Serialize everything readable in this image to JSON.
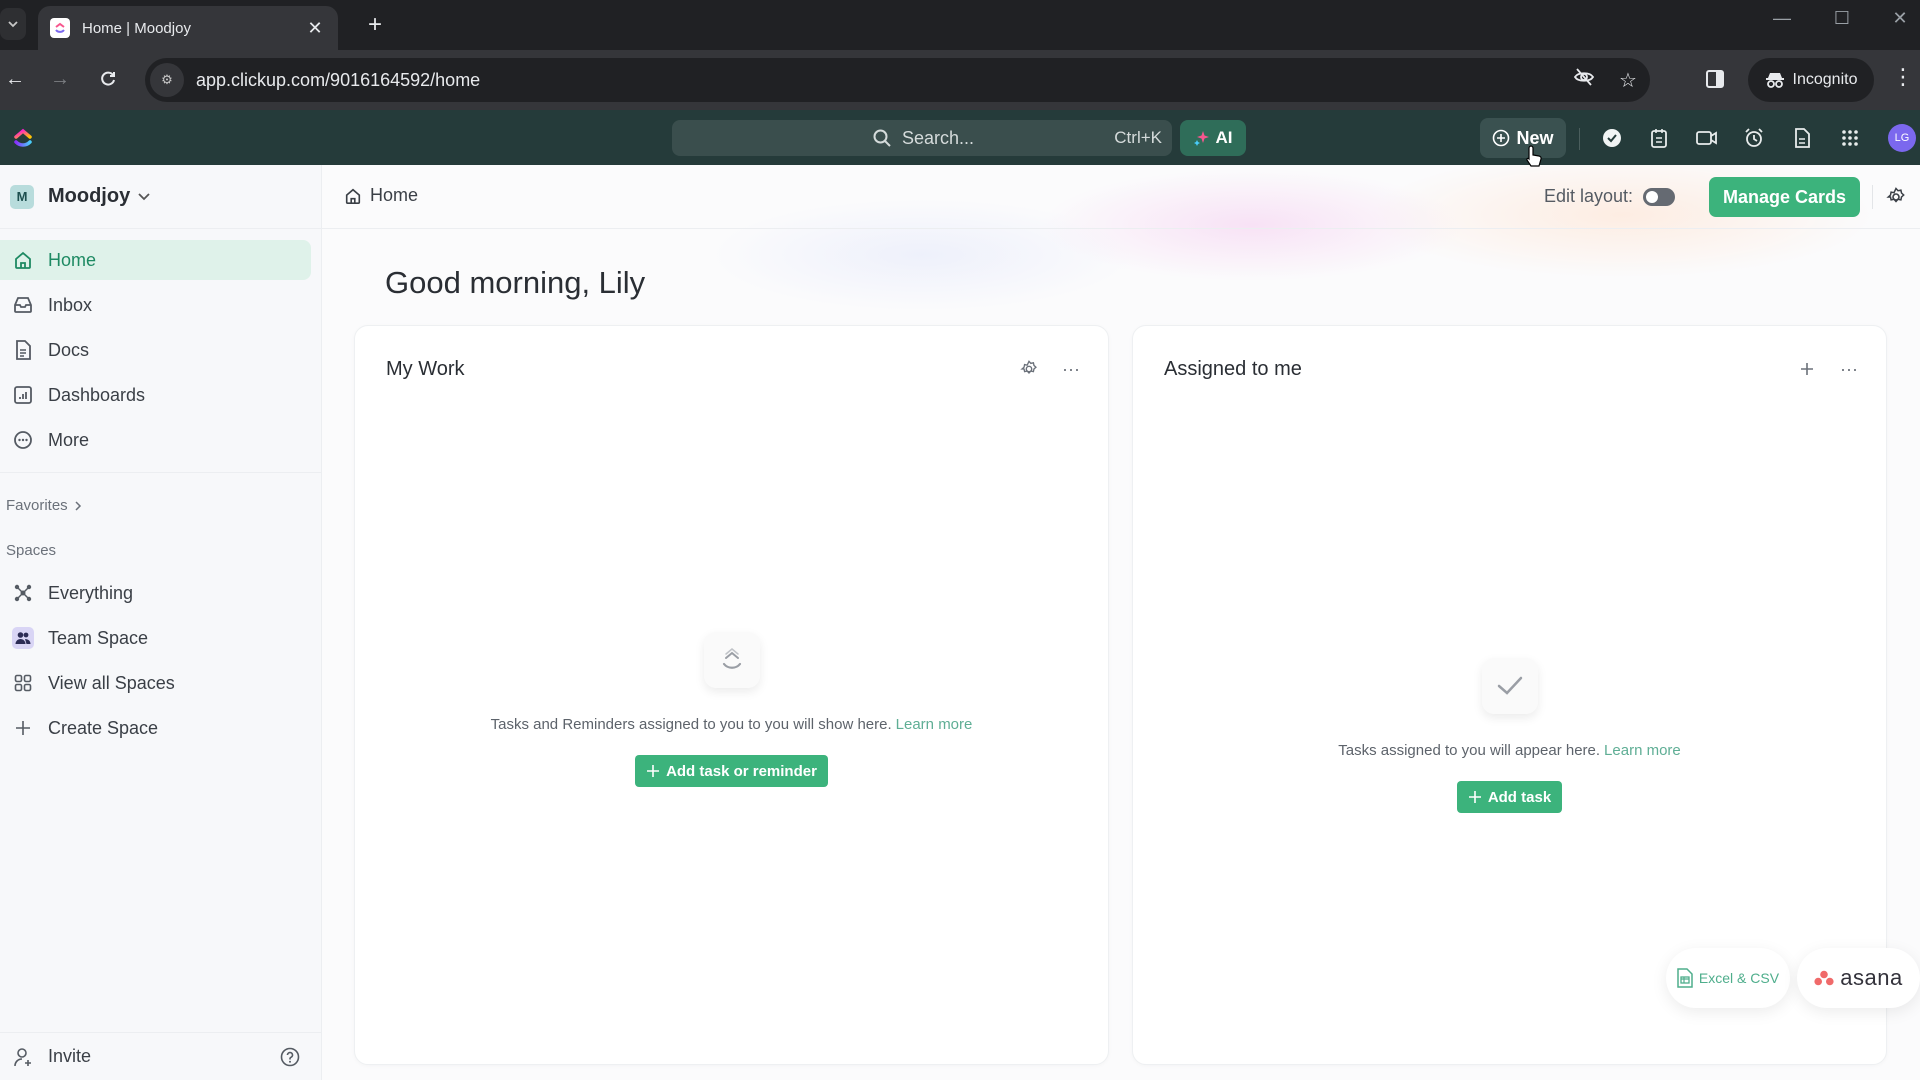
{
  "browser": {
    "tab_title": "Home | Moodjoy",
    "url": "app.clickup.com/9016164592/home",
    "incognito_label": "Incognito"
  },
  "toolbar": {
    "search_placeholder": "Search...",
    "search_shortcut": "Ctrl+K",
    "ai_label": "AI",
    "new_label": "New",
    "avatar_initials": "LG",
    "icons": [
      "check-circle-icon",
      "notepad-icon",
      "video-icon",
      "alarm-clock-icon",
      "document-icon",
      "apps-grid-icon"
    ]
  },
  "sidebar": {
    "workspace_initial": "M",
    "workspace_name": "Moodjoy",
    "nav": [
      {
        "label": "Home",
        "icon": "home-icon",
        "active": true
      },
      {
        "label": "Inbox",
        "icon": "inbox-icon"
      },
      {
        "label": "Docs",
        "icon": "docs-icon"
      },
      {
        "label": "Dashboards",
        "icon": "dashboards-icon"
      },
      {
        "label": "More",
        "icon": "more-icon"
      }
    ],
    "favorites_label": "Favorites",
    "spaces_label": "Spaces",
    "spaces": [
      {
        "label": "Everything",
        "icon": "everything-icon"
      },
      {
        "label": "Team Space",
        "icon": "team-icon"
      },
      {
        "label": "View all Spaces",
        "icon": "grid-icon"
      },
      {
        "label": "Create Space",
        "icon": "plus-icon"
      }
    ],
    "invite_label": "Invite"
  },
  "main": {
    "breadcrumb": "Home",
    "edit_layout_label": "Edit layout:",
    "edit_layout_on": false,
    "manage_cards_label": "Manage Cards",
    "greeting": "Good morning, Lily",
    "cards": [
      {
        "title": "My Work",
        "empty_text": "Tasks and Reminders assigned to you to you will show here.",
        "learn_more": "Learn more",
        "button_label": "Add task or reminder"
      },
      {
        "title": "Assigned to me",
        "empty_text": "Tasks assigned to you will appear here.",
        "learn_more": "Learn more",
        "button_label": "Add task"
      }
    ],
    "imports": {
      "excel_label": "Excel & CSV",
      "asana_label": "asana"
    }
  },
  "colors": {
    "accent_green": "#3cb37c",
    "toolbar_bg": "#253b3a",
    "active_nav_bg": "#dff2ea",
    "avatar_purple": "#7b68ee"
  }
}
